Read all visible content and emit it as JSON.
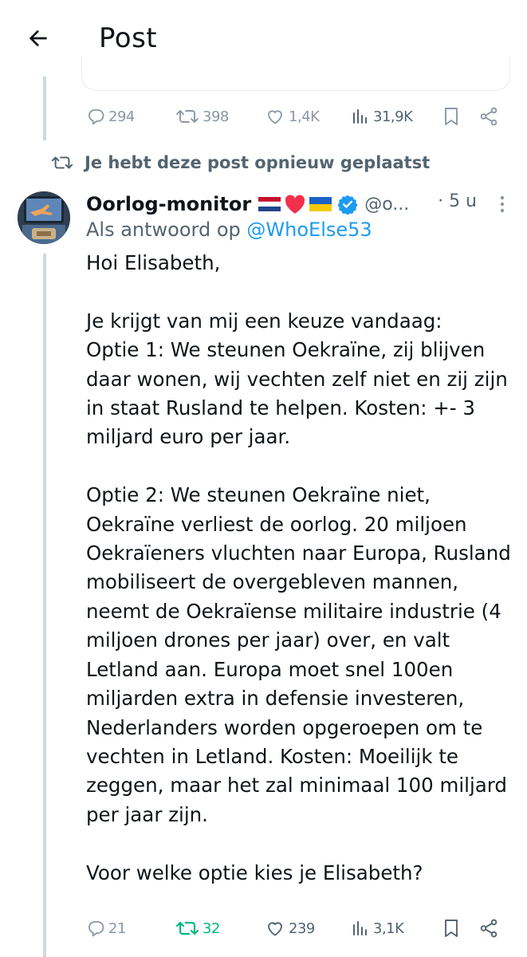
{
  "header": {
    "title": "Post"
  },
  "previous_post": {
    "actions": {
      "replies": "294",
      "reposts": "398",
      "likes": "1,4K",
      "views": "31,9K"
    }
  },
  "repost_note": "Je hebt deze post opnieuw geplaatst",
  "post": {
    "author_name": "Oorlog-monitor",
    "flags": [
      "netherlands-flag",
      "red-heart",
      "ukraine-flag"
    ],
    "verified": true,
    "handle": "@o...",
    "time": "· 5 u",
    "reply_prefix": "Als antwoord op ",
    "reply_mention": "@WhoElse53",
    "text": "Hoi Elisabeth,\n\nJe krijgt van mij een keuze vandaag:\nOptie 1: We steunen Oekraïne, zij blijven daar wonen, wij vechten zelf niet en zij zijn in staat Rusland te helpen. Kosten: +- 3 miljard euro per jaar.\n\nOptie 2: We steunen Oekraïne niet, Oekraïne verliest de oorlog. 20 miljoen Oekraïeners vluchten naar Europa, Rusland mobiliseert de overgebleven mannen, neemt de Oekraïense militaire industrie (4 miljoen drones per jaar) over, en valt Letland aan. Europa moet snel 100en miljarden extra in defensie investeren, Nederlanders worden opgeroepen om te vechten in Letland. Kosten: Moeilijk te zeggen, maar het zal minimaal 100 miljard per jaar zijn.\n\nVoor welke optie kies je Elisabeth?",
    "actions": {
      "replies": "21",
      "reposts": "32",
      "likes": "239",
      "views": "3,1K"
    }
  },
  "colors": {
    "accent": "#1d9bf0",
    "repost_active": "#00ba7c",
    "muted": "#536471",
    "thread_line": "#cfd9de"
  }
}
